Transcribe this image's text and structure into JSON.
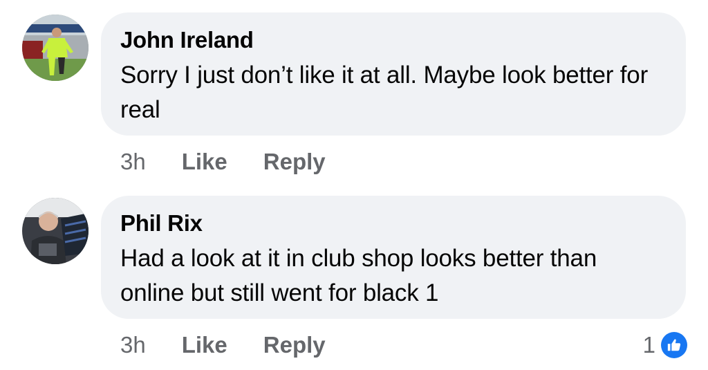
{
  "comments": [
    {
      "author": "John Ireland",
      "text": "Sorry I just don’t like it at all. Maybe look better for real",
      "time": "3h",
      "like_label": "Like",
      "reply_label": "Reply",
      "avatar_icon": "user-photo-football-player"
    },
    {
      "author": "Phil Rix",
      "text": "Had a look at it in club shop looks better than online but still went for black 1",
      "time": "3h",
      "like_label": "Like",
      "reply_label": "Reply",
      "reaction_count": "1",
      "reaction_icon": "thumbs-up-icon",
      "avatar_icon": "user-photo-man"
    }
  ],
  "colors": {
    "bubble": "#f0f2f5",
    "secondary_text": "#65676b",
    "like_blue": "#1877f2"
  }
}
